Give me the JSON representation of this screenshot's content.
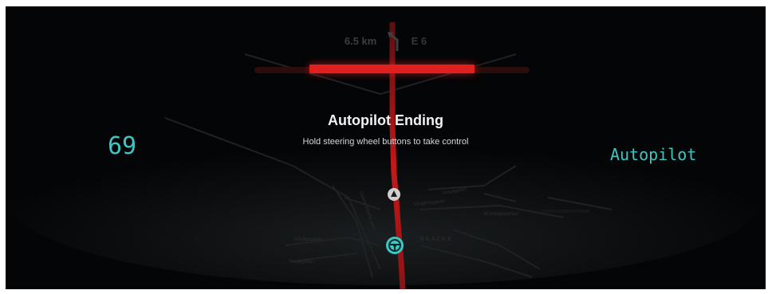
{
  "navigation": {
    "distance": "6.5 km",
    "road": "E 6",
    "turn_icon": "turn-left-arrow-icon"
  },
  "alert": {
    "title": "Autopilot Ending",
    "message": "Hold steering wheel buttons to take control"
  },
  "speed": {
    "value": "69"
  },
  "status": {
    "mode": "Autopilot"
  },
  "progress": {
    "fraction": 0.6
  },
  "map": {
    "labels": [
      "Krokängsparken",
      "BRÄCKE",
      "Vingårdsgatan",
      "Doktor Allards gata",
      "Hövågsgatan",
      "Vingagatan",
      "Skogsgatan"
    ]
  },
  "colors": {
    "accent": "#3cc7c2",
    "route": "#e01f1f",
    "background": "#040506"
  },
  "icons": {
    "vehicle": "car-position-icon",
    "steering": "steering-wheel-icon"
  }
}
